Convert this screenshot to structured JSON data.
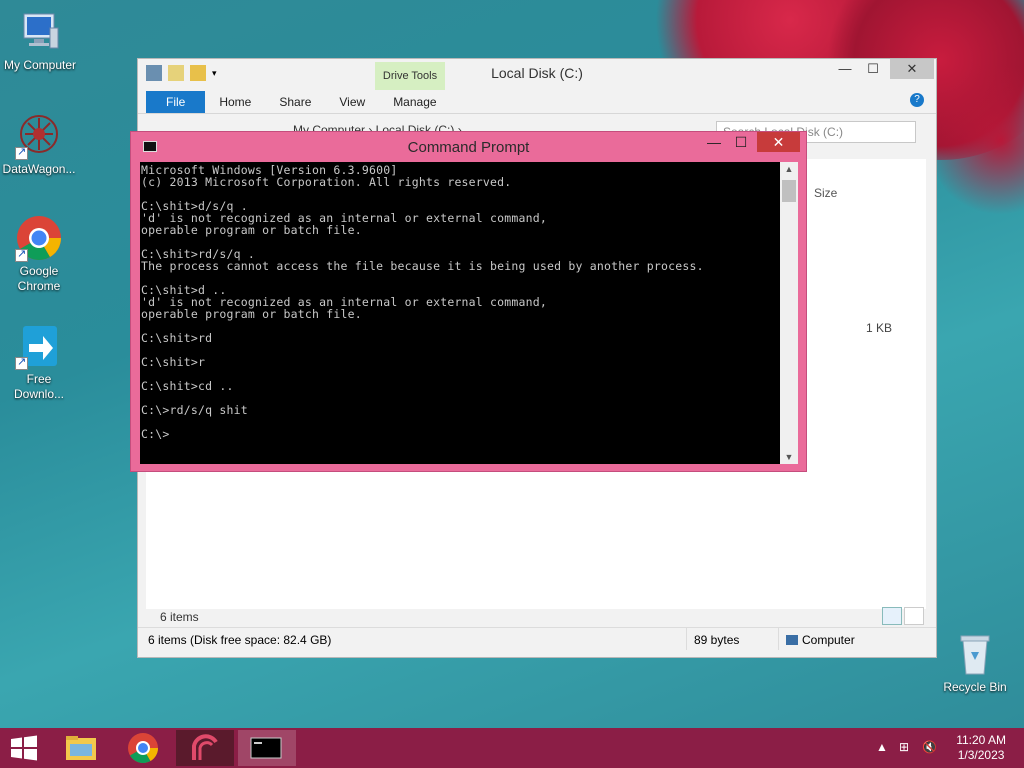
{
  "desktop": {
    "icons": [
      {
        "label": "My Computer"
      },
      {
        "label": "DataWagon..."
      },
      {
        "label": "Google Chrome"
      },
      {
        "label": "Free Downlo..."
      },
      {
        "label": "Recycle Bin"
      }
    ]
  },
  "explorer": {
    "title": "Local Disk (C:)",
    "contextual_tab": "Drive Tools",
    "tabs": [
      "File",
      "Home",
      "Share",
      "View",
      "Manage"
    ],
    "breadcrumb": "My Computer  ›  Local Disk (C:)  ›",
    "search_placeholder": "Search Local Disk (C:)",
    "column_size": "Size",
    "row_size": "1 KB",
    "items_count": "6 items",
    "status_items": "6 items (Disk free space: 82.4 GB)",
    "status_bytes": "89 bytes",
    "status_location": "Computer"
  },
  "cmd": {
    "title": "Command Prompt",
    "output": "Microsoft Windows [Version 6.3.9600]\n(c) 2013 Microsoft Corporation. All rights reserved.\n\nC:\\shit>d/s/q .\n'd' is not recognized as an internal or external command,\noperable program or batch file.\n\nC:\\shit>rd/s/q .\nThe process cannot access the file because it is being used by another process.\n\nC:\\shit>d ..\n'd' is not recognized as an internal or external command,\noperable program or batch file.\n\nC:\\shit>rd\n\nC:\\shit>r\n\nC:\\shit>cd ..\n\nC:\\>rd/s/q shit\n\nC:\\>"
  },
  "taskbar": {
    "time": "11:20 AM",
    "date": "1/3/2023"
  },
  "colors": {
    "cmd_frame": "#ea6b9a",
    "taskbar": "#8b1e46",
    "file_tab": "#1979ca"
  }
}
